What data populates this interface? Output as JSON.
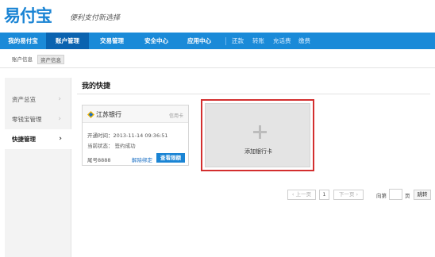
{
  "header": {
    "logo": "易付宝",
    "slogan": "便利支付新选择"
  },
  "nav": {
    "items": [
      "我的易付宝",
      "账户管理",
      "交易管理",
      "安全中心",
      "应用中心"
    ],
    "active_index": 1,
    "sub_items": [
      "还款",
      "转账",
      "充话费",
      "缴费"
    ]
  },
  "subnav": {
    "tabs": [
      "账户信息",
      "资产信息"
    ],
    "active_index": 1
  },
  "sidebar": {
    "items": [
      "资产总览",
      "零钱宝管理",
      "快捷管理"
    ],
    "active_index": 2
  },
  "main": {
    "title": "我的快捷"
  },
  "card": {
    "bank_name": "江苏银行",
    "card_type": "信用卡",
    "open_time": "开通时间：2013-11-14 09:36:51",
    "status": "当前状态：  签约成功",
    "limit": "尾号8888",
    "unbind_label": "解除绑定",
    "view_limit_label": "查看限额"
  },
  "add_card": {
    "label": "添加银行卡"
  },
  "pager": {
    "prev": "‹ 上一页",
    "current_page": "1",
    "next": "下一页 ›",
    "goto_prefix": "向第",
    "goto_suffix": "页",
    "goto_button": "跳转"
  },
  "colors": {
    "brand_blue": "#1a8ad8",
    "nav_active": "#0a63b0",
    "highlight_red": "#d32f2f"
  }
}
